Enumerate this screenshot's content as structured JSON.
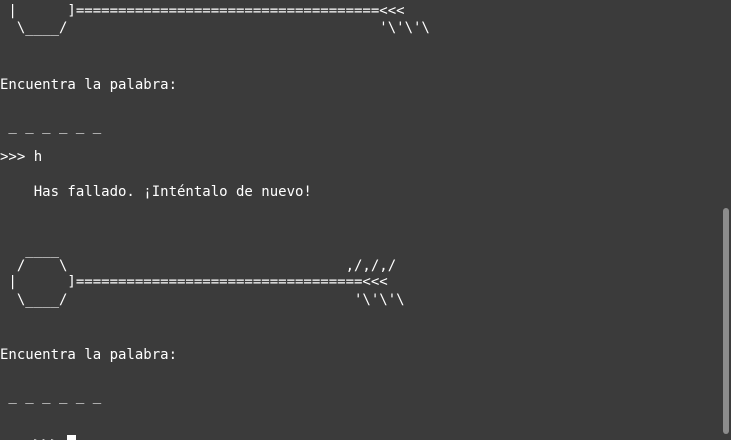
{
  "terminal": {
    "lines": {
      "l1": " |      ]====================================<<<",
      "l2": "  \\____/                                     '\\'\\'\\",
      "l3": "Encuentra la palabra:",
      "l4": " _ _ _ _ _ _",
      "l5": ">>> h",
      "l6": "    Has fallado. ¡Inténtalo de nuevo!",
      "l7": "   ____",
      "l8": "  /    \\                                 ,/,/,/",
      "l9": " |      ]==================================<<<",
      "l10": "  \\____/                                  '\\'\\'\\",
      "l11": "Encuentra la palabra:",
      "l12": " _ _ _ _ _ _",
      "prompt": ">>> "
    }
  }
}
